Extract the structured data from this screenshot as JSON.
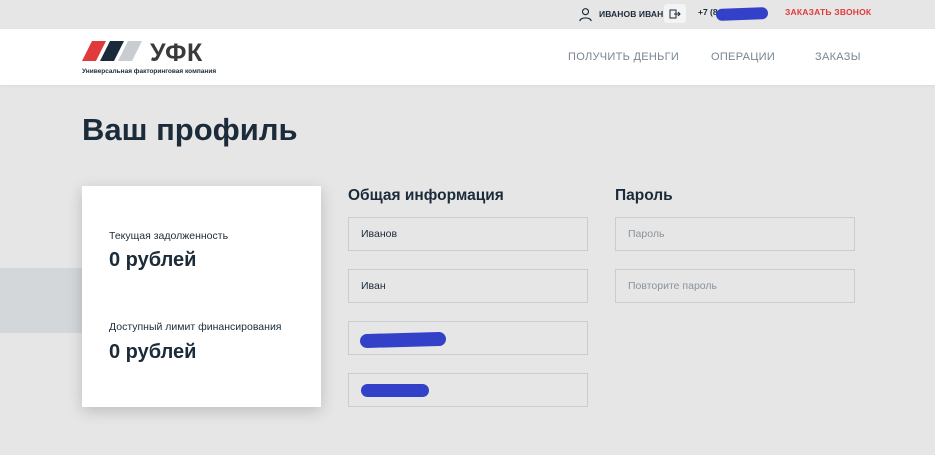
{
  "topbar": {
    "user_name": "ИВАНОВ ИВАН",
    "phone": "+7 (84",
    "callback_label": "ЗАКАЗАТЬ ЗВОНОК"
  },
  "header": {
    "brand": "УФК",
    "tagline": "Универсальная факторинговая компания",
    "nav": [
      "ПОЛУЧИТЬ ДЕНЬГИ",
      "ОПЕРАЦИИ",
      "ЗАКАЗЫ"
    ]
  },
  "page": {
    "title": "Ваш профиль"
  },
  "summary": {
    "debt_label": "Текущая задолженность",
    "debt_value": "0 рублей",
    "limit_label": "Доступный лимит финансирования",
    "limit_value": "0 рублей"
  },
  "general": {
    "title": "Общая информация",
    "last_name": "Иванов",
    "first_name": "Иван",
    "field3": "",
    "field4": ""
  },
  "password": {
    "title": "Пароль",
    "password_placeholder": "Пароль",
    "repeat_placeholder": "Повторите пароль"
  },
  "colors": {
    "background": "#e6e6e6",
    "text": "#1c2b39",
    "accent_red": "#e03a3a",
    "redaction": "#3340c8"
  },
  "icons": {
    "user": "user-icon",
    "logout": "logout-icon",
    "logo": "ufk-logo-icon"
  }
}
